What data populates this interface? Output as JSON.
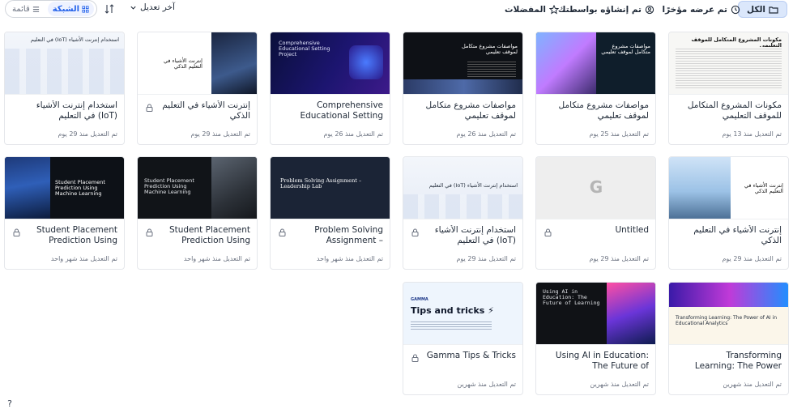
{
  "toolbar": {
    "filters": {
      "all": "الكل",
      "recent": "تم عرضه مؤخرًا",
      "created_by_you": "تم إنشاؤه بواسطتك",
      "favorites": "المفضلات"
    },
    "sort_label": "آخر تعديل",
    "view_grid": "الشبكة",
    "view_list": "قائمة"
  },
  "cards": [
    {
      "title": "مكونات المشروع المتكامل للموقف التعليمي",
      "meta": "تم التعديل منذ 13 يوم",
      "thumb_text": "مكونات المشروع المتكامل للموقف التعليمي",
      "locked": false
    },
    {
      "title": "مواصفات مشروع متكامل لموقف تعليمي",
      "meta": "تم التعديل منذ 25 يوم",
      "thumb_text": "مواصفات مشروع متكامل لموقف تعليمي",
      "locked": false
    },
    {
      "title": "مواصفات مشروع متكامل لموقف تعليمي",
      "meta": "تم التعديل منذ 26 يوم",
      "thumb_text": "مواصفات مشروع متكامل لموقف تعليمي",
      "locked": false
    },
    {
      "title": "Comprehensive Educational Setting Project",
      "meta": "تم التعديل منذ 26 يوم",
      "thumb_text": "Comprehensive Educational Setting Project",
      "locked": false
    },
    {
      "title": "إنترنت الأشياء في التعليم الذكي",
      "meta": "تم التعديل منذ 29 يوم",
      "thumb_text": "إنترنت الأشياء في التعليم الذكي",
      "locked": true
    },
    {
      "title": "استخدام إنترنت الأشياء (IoT) في التعليم",
      "meta": "تم التعديل منذ 29 يوم",
      "thumb_text": "استخدام إنترنت الأشياء (IoT) في التعليم",
      "locked": false
    },
    {
      "title": "إنترنت الأشياء في التعليم الذكي",
      "meta": "تم التعديل منذ 29 يوم",
      "thumb_text": "إنترنت الأشياء في التعليم الذكي",
      "locked": false
    },
    {
      "title": "Untitled",
      "meta": "تم التعديل منذ 29 يوم",
      "thumb_text": "",
      "locked": true
    },
    {
      "title": "استخدام إنترنت الأشياء (IoT) في التعليم",
      "meta": "تم التعديل منذ 29 يوم",
      "thumb_text": "استخدام إنترنت الأشياء (IoT) في التعليم",
      "locked": true
    },
    {
      "title": "Problem Solving Assignment – Leadership...",
      "meta": "تم التعديل منذ شهر واحد",
      "thumb_text": "Problem Solving Assignment – Leadership Lab",
      "locked": true
    },
    {
      "title": "Student Placement Prediction Using Machine...",
      "meta": "تم التعديل منذ شهر واحد",
      "thumb_text": "Student Placement Prediction Using Machine Learning",
      "locked": true
    },
    {
      "title": "Student Placement Prediction Using Machine...",
      "meta": "تم التعديل منذ شهر واحد",
      "thumb_text": "Student Placement Prediction Using Machine Learning",
      "locked": true
    },
    {
      "title": "Transforming Learning: The Power of AI in Educational...",
      "meta": "تم التعديل منذ شهرين",
      "thumb_text": "Transforming Learning: The Power of AI in Educational Analytics",
      "locked": false
    },
    {
      "title": "Using AI in Education: The Future of Learning",
      "meta": "تم التعديل منذ شهرين",
      "thumb_text": "Using AI in Education: The Future of Learning",
      "locked": false
    },
    {
      "title": "Gamma Tips & Tricks",
      "meta": "تم التعديل منذ شهرين",
      "thumb_text": "Tips and tricks ⚡",
      "thumb_brand": "GAMMA",
      "locked": true
    }
  ],
  "help": "?",
  "colors": {
    "accent": "#2563eb",
    "pill_bg": "#dbe7fb"
  }
}
